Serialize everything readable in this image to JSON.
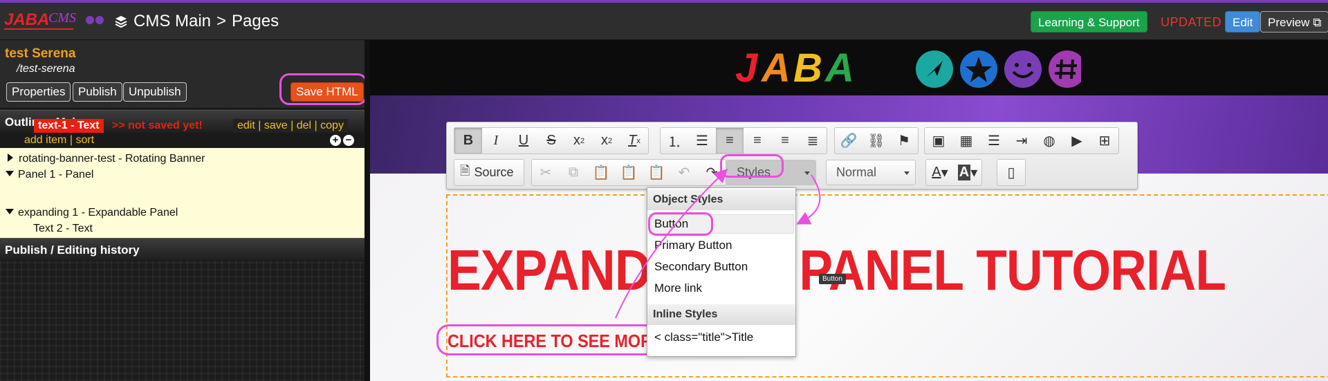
{
  "topbar": {
    "section": "CMS Main",
    "separator": ">",
    "page": "Pages",
    "learning_label": "Learning & Support",
    "status": "UPDATED",
    "edit_label": "Edit",
    "preview_label": "Preview"
  },
  "page": {
    "name": "test Serena",
    "path": "/test-serena",
    "buttons": {
      "properties": "Properties",
      "publish": "Publish",
      "unpublish": "Unpublish",
      "save_html": "Save HTML"
    }
  },
  "outline": {
    "title": "Outline - Main",
    "add_item": "add item",
    "sort": "sort",
    "bar_sep": "|",
    "nodes": [
      {
        "label": "rotating-banner-test - Rotating Banner"
      },
      {
        "label": "Panel 1 - Panel"
      },
      {
        "label": "text-1 - Text",
        "status": ">> not saved yet!"
      },
      {
        "label": "expanding 1 - Expandable Panel"
      },
      {
        "label": "Text 2 - Text"
      }
    ],
    "actions": [
      "edit",
      "save",
      "del",
      "copy"
    ]
  },
  "history": {
    "title": "Publish / Editing history"
  },
  "editor": {
    "source_label": "Source",
    "styles_label": "Styles",
    "format_label": "Normal",
    "dropdown": {
      "object_header": "Object Styles",
      "object_items": [
        "Button",
        "Primary Button",
        "Secondary Button",
        "More link"
      ],
      "inline_header": "Inline Styles",
      "inline_items": [
        "< class=\"title\">Title"
      ]
    },
    "tooltip": "Button"
  },
  "content": {
    "title": "EXPANDABLE PANEL TUTORIAL",
    "link": "CLICK HERE TO SEE MORE"
  },
  "colors": {
    "accent": "#e94fe0",
    "title_red": "#e8212b",
    "save_orange": "#e8511c",
    "learning_green": "#1aa34a"
  }
}
